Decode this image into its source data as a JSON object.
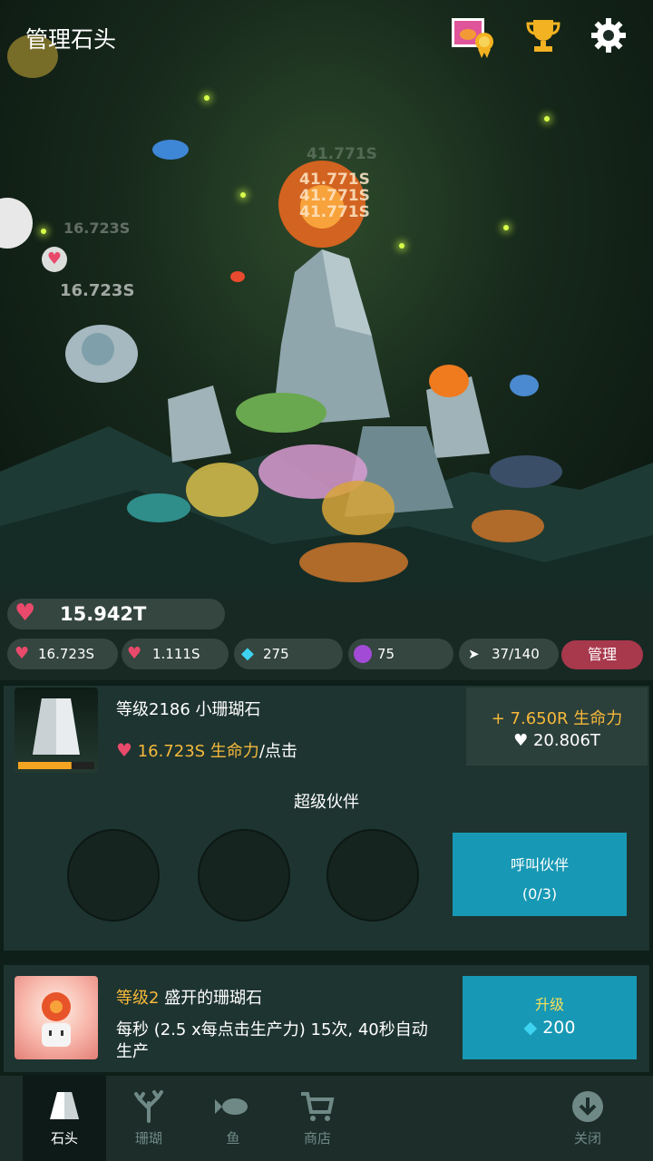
{
  "header": {
    "title": "管理石头"
  },
  "scene": {
    "floating_labels": [
      "16.723S",
      "16.723S"
    ],
    "stacked_numbers": [
      "41.771S",
      "41.771S",
      "41.771S",
      "41.771S"
    ]
  },
  "stats": {
    "life_total": "15.942T",
    "tap_rate": "16.723S",
    "auto_rate": "1.111S",
    "gems": "275",
    "purple": "75",
    "fish_count": "37/140",
    "manage_label": "管理"
  },
  "stone": {
    "level_name": "等级2186 小珊瑚石",
    "per_tap_amount": "16.723S 生命力",
    "per_tap_suffix": "/点击",
    "reward_gain": "+ 7.650R 生命力",
    "reward_cost": "20.806T",
    "progress": 0.7
  },
  "partners": {
    "title": "超级伙伴",
    "call_label": "呼叫伙伴",
    "call_count": "(0/3)"
  },
  "upgrade": {
    "level": "等级2",
    "name": "盛开的珊瑚石",
    "desc": "每秒 (2.5 x每点击生产力) 15次, 40秒自动生产",
    "button_label": "升级",
    "cost": "200"
  },
  "nav": [
    {
      "label": "石头"
    },
    {
      "label": "珊瑚"
    },
    {
      "label": "鱼"
    },
    {
      "label": "商店"
    },
    {
      "label": "关闭"
    }
  ],
  "colors": {
    "accent_blue": "#1798b4",
    "gold": "#f6b93b",
    "manage_red": "#a8384c"
  }
}
